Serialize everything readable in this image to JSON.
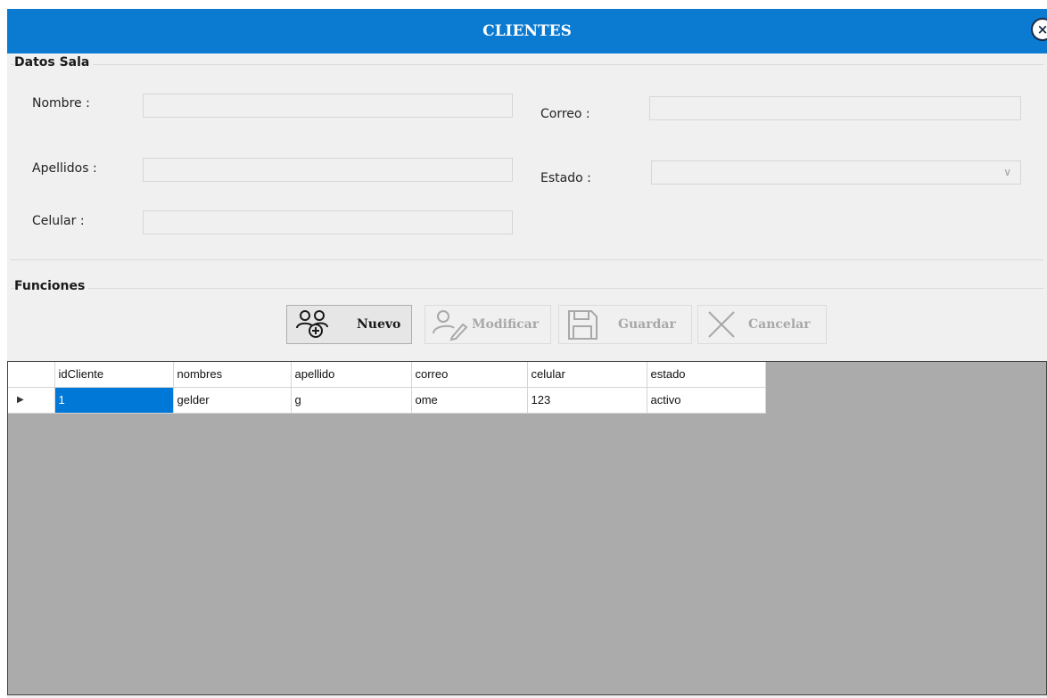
{
  "window": {
    "title": "CLIENTES",
    "close_glyph": "×"
  },
  "datos_sala": {
    "title": "Datos Sala",
    "nombre_label": "Nombre :",
    "nombre_value": "",
    "apellidos_label": "Apellidos :",
    "apellidos_value": "",
    "celular_label": "Celular :",
    "celular_value": "",
    "correo_label": "Correo :",
    "correo_value": "",
    "estado_label": "Estado :",
    "estado_value": ""
  },
  "funciones": {
    "title": "Funciones",
    "nuevo_label": "Nuevo",
    "modificar_label": "Modificar",
    "guardar_label": "Guardar",
    "cancelar_label": "Cancelar"
  },
  "grid": {
    "columns": [
      "idCliente",
      "nombres",
      "apellido",
      "correo",
      "celular",
      "estado"
    ],
    "rows": [
      {
        "indicator": "▶",
        "cells": [
          "1",
          "gelder",
          "g",
          "ome",
          "123",
          "activo"
        ]
      }
    ]
  },
  "colors": {
    "titlebar": "#0b7ad1",
    "selection": "#0078d7",
    "grid_background": "#ababab"
  }
}
